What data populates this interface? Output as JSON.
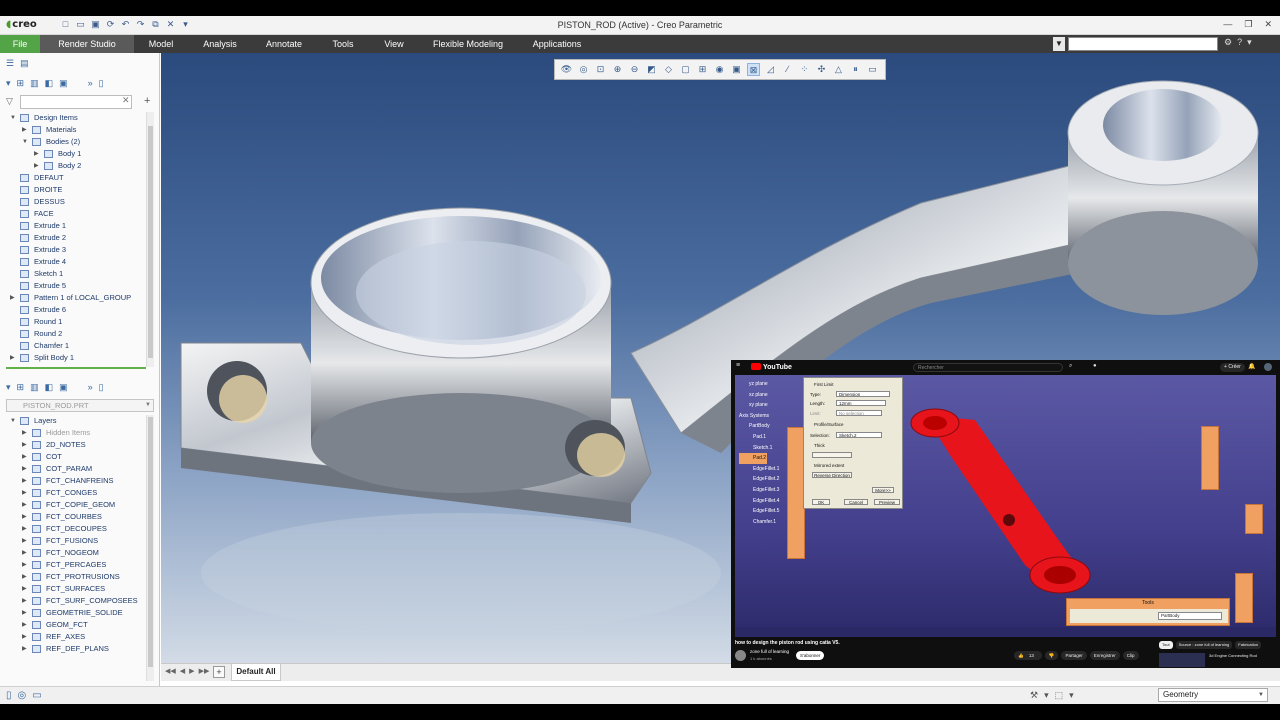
{
  "window": {
    "title": "PISTON_ROD (Active) - Creo Parametric",
    "app_logo": "creo"
  },
  "quick_access": [
    "new-icon",
    "open-icon",
    "save-icon",
    "regenerate-icon",
    "undo-icon",
    "redo-icon",
    "windows-icon",
    "close-window-icon"
  ],
  "menu": {
    "items": [
      "File",
      "Render Studio",
      "Model",
      "Analysis",
      "Annotate",
      "Tools",
      "View",
      "Flexible Modeling",
      "Applications"
    ],
    "active": "Render Studio",
    "search_value": ""
  },
  "model_tree": {
    "items": [
      {
        "label": "Design Items",
        "level": 0,
        "expand": "down"
      },
      {
        "label": "Materials",
        "level": 1,
        "expand": "right"
      },
      {
        "label": "Bodies (2)",
        "level": 1,
        "expand": "down"
      },
      {
        "label": "Body 1",
        "level": 2,
        "expand": "right"
      },
      {
        "label": "Body 2",
        "level": 2,
        "expand": "right"
      },
      {
        "label": "DEFAUT",
        "level": 0,
        "expand": ""
      },
      {
        "label": "DROITE",
        "level": 0,
        "expand": ""
      },
      {
        "label": "DESSUS",
        "level": 0,
        "expand": ""
      },
      {
        "label": "FACE",
        "level": 0,
        "expand": ""
      },
      {
        "label": "Extrude 1",
        "level": 0,
        "expand": ""
      },
      {
        "label": "Extrude 2",
        "level": 0,
        "expand": ""
      },
      {
        "label": "Extrude 3",
        "level": 0,
        "expand": ""
      },
      {
        "label": "Extrude 4",
        "level": 0,
        "expand": ""
      },
      {
        "label": "Sketch 1",
        "level": 0,
        "expand": ""
      },
      {
        "label": "Extrude 5",
        "level": 0,
        "expand": ""
      },
      {
        "label": "Pattern 1 of LOCAL_GROUP",
        "level": 0,
        "expand": "right"
      },
      {
        "label": "Extrude 6",
        "level": 0,
        "expand": ""
      },
      {
        "label": "Round 1",
        "level": 0,
        "expand": ""
      },
      {
        "label": "Round 2",
        "level": 0,
        "expand": ""
      },
      {
        "label": "Chamfer 1",
        "level": 0,
        "expand": ""
      },
      {
        "label": "Split Body 1",
        "level": 0,
        "expand": "right"
      }
    ]
  },
  "layer_tree": {
    "model_select": "PISTON_ROD.PRT",
    "items": [
      {
        "label": "Layers",
        "level": 0,
        "expand": "down",
        "gray": false
      },
      {
        "label": "Hidden Items",
        "level": 1,
        "expand": "right",
        "gray": true
      },
      {
        "label": "2D_NOTES",
        "level": 1,
        "expand": "right",
        "gray": false
      },
      {
        "label": "COT",
        "level": 1,
        "expand": "right",
        "gray": false
      },
      {
        "label": "COT_PARAM",
        "level": 1,
        "expand": "right",
        "gray": false
      },
      {
        "label": "FCT_CHANFREINS",
        "level": 1,
        "expand": "right",
        "gray": false
      },
      {
        "label": "FCT_CONGES",
        "level": 1,
        "expand": "right",
        "gray": false
      },
      {
        "label": "FCT_COPIE_GEOM",
        "level": 1,
        "expand": "right",
        "gray": false
      },
      {
        "label": "FCT_COURBES",
        "level": 1,
        "expand": "right",
        "gray": false
      },
      {
        "label": "FCT_DECOUPES",
        "level": 1,
        "expand": "right",
        "gray": false
      },
      {
        "label": "FCT_FUSIONS",
        "level": 1,
        "expand": "right",
        "gray": false
      },
      {
        "label": "FCT_NOGEOM",
        "level": 1,
        "expand": "right",
        "gray": false
      },
      {
        "label": "FCT_PERCAGES",
        "level": 1,
        "expand": "right",
        "gray": false
      },
      {
        "label": "FCT_PROTRUSIONS",
        "level": 1,
        "expand": "right",
        "gray": false
      },
      {
        "label": "FCT_SURFACES",
        "level": 1,
        "expand": "right",
        "gray": false
      },
      {
        "label": "FCT_SURF_COMPOSEES",
        "level": 1,
        "expand": "right",
        "gray": false
      },
      {
        "label": "GEOMETRIE_SOLIDE",
        "level": 1,
        "expand": "right",
        "gray": false
      },
      {
        "label": "GEOM_FCT",
        "level": 1,
        "expand": "right",
        "gray": false
      },
      {
        "label": "REF_AXES",
        "level": 1,
        "expand": "right",
        "gray": false
      },
      {
        "label": "REF_DEF_PLANS",
        "level": 1,
        "expand": "right",
        "gray": false
      }
    ]
  },
  "graphics_toolbar": [
    "refit-icon",
    "zoom-in-icon",
    "zoom-out-icon",
    "repaint-icon",
    "display-style-icon",
    "saved-orientations-icon",
    "view-manager-icon",
    "datum-display-icon",
    "spin-center-icon",
    "annotation-display-icon",
    "pause-icon"
  ],
  "sheet_tabs": {
    "active": "Default All"
  },
  "status": {
    "filter_value": "Geometry"
  },
  "colors": {
    "file_tab": "#52a447",
    "menubar": "#3b3b3b",
    "part_highlight": "#e8141b",
    "tree_text": "#1e3a6a"
  },
  "video_overlay": {
    "logo": "YouTube",
    "search_placeholder": "Rechercher",
    "create_label": "Créer",
    "title": "how to design the piston rod using catia V5.",
    "channel": "zone full of learning",
    "subscribers": "1 k abonnés",
    "subscribe_label": "S'abonner",
    "likes": "13",
    "actions": [
      "Partager",
      "Enregistrer",
      "Clip"
    ],
    "chips": [
      "Tout",
      "Source : zone full of learning",
      "Fabrication"
    ],
    "related_title": "3d Engine Connecting Rod",
    "catia_tree": [
      "yz plane",
      "xz plane",
      "xy plane",
      "PartBody",
      "Pad.1",
      "Sketch.1",
      "Pad.2",
      "EdgeFillet.1",
      "EdgeFillet.2",
      "EdgeFillet.3",
      "EdgeFillet.4",
      "EdgeFillet.5",
      "Chamfer.1"
    ],
    "catia_root": "Axis Systems",
    "dialog": {
      "section": "First Limit",
      "type_label": "Type:",
      "type_value": "Dimension",
      "length_label": "Length:",
      "length_value": "12mm",
      "limit_label": "Limit:",
      "limit_value": "No selection",
      "profile_section": "Profile/Surface",
      "selection_label": "Selection:",
      "selection_value": "Sketch.2",
      "thick_label": "Thick",
      "mirrored_label": "Mirrored extent",
      "reverse_label": "Reverse Direction",
      "more_label": "More>>",
      "ok_label": "OK",
      "cancel_label": "Cancel",
      "preview_label": "Preview"
    },
    "tools_title": "Tools",
    "tools_combo": "PartBody"
  }
}
